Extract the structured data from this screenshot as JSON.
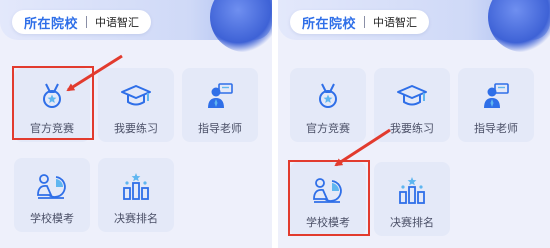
{
  "header": {
    "school_label": "所在院校",
    "school_name": "中语智汇"
  },
  "tiles": {
    "official_competition": "官方竞赛",
    "my_practice": "我要练习",
    "guide_teacher": "指导老师",
    "school_mock": "学校模考",
    "final_ranking": "决赛排名"
  },
  "icons": {
    "official_competition": "medal-icon",
    "my_practice": "graduation-cap-icon",
    "guide_teacher": "teacher-icon",
    "school_mock": "exam-chart-icon",
    "final_ranking": "ranking-bars-icon"
  },
  "colors": {
    "accent_blue": "#2f6fe8",
    "highlight_red": "#e23b2e",
    "tile_bg": "#e4e9f8",
    "panel_bg": "#eef0fb"
  }
}
